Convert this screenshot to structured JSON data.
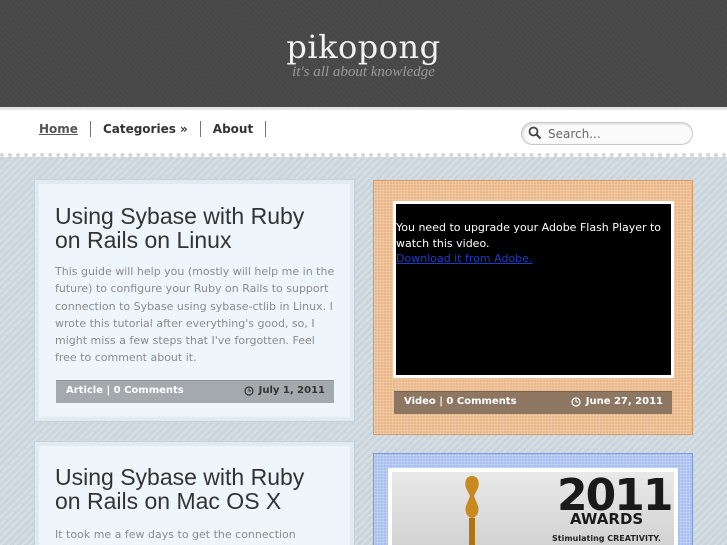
{
  "header": {
    "title": "pikopong",
    "tagline": "it's all about knowledge"
  },
  "nav": {
    "items": [
      {
        "label": "Home"
      },
      {
        "label": "Categories »"
      },
      {
        "label": "About"
      }
    ]
  },
  "search": {
    "placeholder": "Search..."
  },
  "posts": [
    {
      "title": "Using Sybase with Ruby on Rails on Linux",
      "excerpt": "This guide will help you (mostly will help me in the future) to configure your Ruby on Rails to support connection to Sybase using sybase-ctlib in Linux. I wrote this tutorial after everything's good, so, I might miss a few steps that I've forgotten. Feel free to comment about it.",
      "meta": "Article | 0 Comments",
      "date": "July 1, 2011"
    },
    {
      "title": "Using Sybase with Ruby on Rails on Mac OS X",
      "excerpt": "It took me a few days to get the connection working."
    }
  ],
  "video": {
    "flash_message": "You need to upgrade your Adobe Flash Player to watch this video.",
    "flash_link": "Download it from Adobe.",
    "meta": "Video | 0 Comments",
    "date": "June 27, 2011"
  },
  "awards": {
    "year": "2011",
    "word": "AWARDS",
    "tag": "Stimulating CREATIVITY."
  },
  "colors": {
    "header_bg": "#474747",
    "page_bg": "#c9d4dc",
    "video_card": "#eab888",
    "awards_card": "#a8bff0"
  }
}
